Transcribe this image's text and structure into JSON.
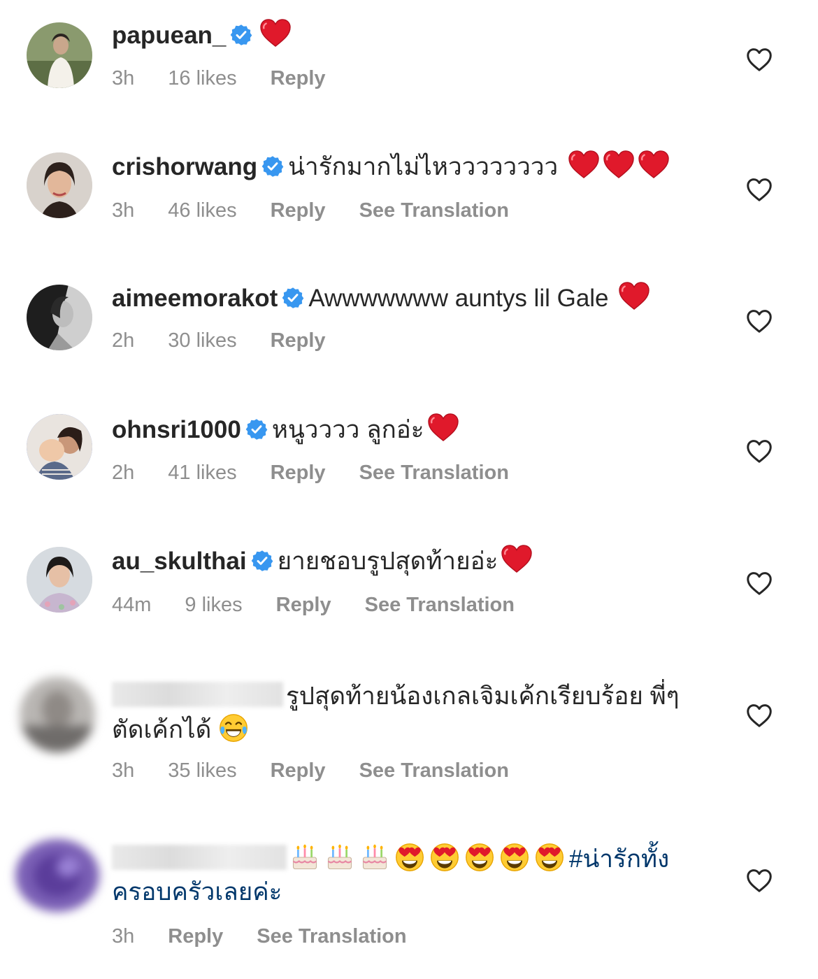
{
  "comments": [
    {
      "username": "papuean_",
      "verified": true,
      "text": "",
      "emoji": [
        "red-heart"
      ],
      "time": "3h",
      "likes": "16 likes",
      "reply": "Reply",
      "translate": ""
    },
    {
      "username": "crishorwang",
      "verified": true,
      "text": "น่ารักมากไม่ไหวววววววว",
      "emoji": [
        "red-heart",
        "red-heart",
        "red-heart"
      ],
      "time": "3h",
      "likes": "46 likes",
      "reply": "Reply",
      "translate": "See Translation"
    },
    {
      "username": "aimeemorakot",
      "verified": true,
      "text": "Awwwwwww auntys lil Gale",
      "emoji": [
        "red-heart"
      ],
      "time": "2h",
      "likes": "30 likes",
      "reply": "Reply",
      "translate": ""
    },
    {
      "username": "ohnsri1000",
      "verified": true,
      "text": "หนูวววว ลูกอ่ะ",
      "emoji": [
        "red-heart"
      ],
      "time": "2h",
      "likes": "41 likes",
      "reply": "Reply",
      "translate": "See Translation"
    },
    {
      "username": "au_skulthai",
      "verified": true,
      "text": "ยายชอบรูปสุดท้ายอ่ะ",
      "emoji": [
        "red-heart"
      ],
      "time": "44m",
      "likes": "9 likes",
      "reply": "Reply",
      "translate": "See Translation"
    },
    {
      "username": "",
      "verified": false,
      "text": "รูปสุดท้ายน้องเกลเจิมเค้กเรียบร้อย พี่ๆตัดเค้กได้",
      "emoji": [
        "face-with-tears-of-joy"
      ],
      "time": "3h",
      "likes": "35 likes",
      "reply": "Reply",
      "translate": "See Translation"
    },
    {
      "username": "",
      "verified": false,
      "text": "",
      "emoji": [
        "birthday-cake",
        "birthday-cake",
        "birthday-cake",
        "heart-eyes",
        "heart-eyes",
        "heart-eyes",
        "heart-eyes",
        "heart-eyes"
      ],
      "hashtag": "#น่ารักทั้งครอบครัวเลยค่ะ",
      "time": "3h",
      "likes": "",
      "reply": "Reply",
      "translate": "See Translation"
    }
  ],
  "colors": {
    "text": "#262626",
    "meta": "#8e8e8e",
    "verified": "#3897f0",
    "heart": "#ed4956",
    "hashtag": "#00376b"
  }
}
